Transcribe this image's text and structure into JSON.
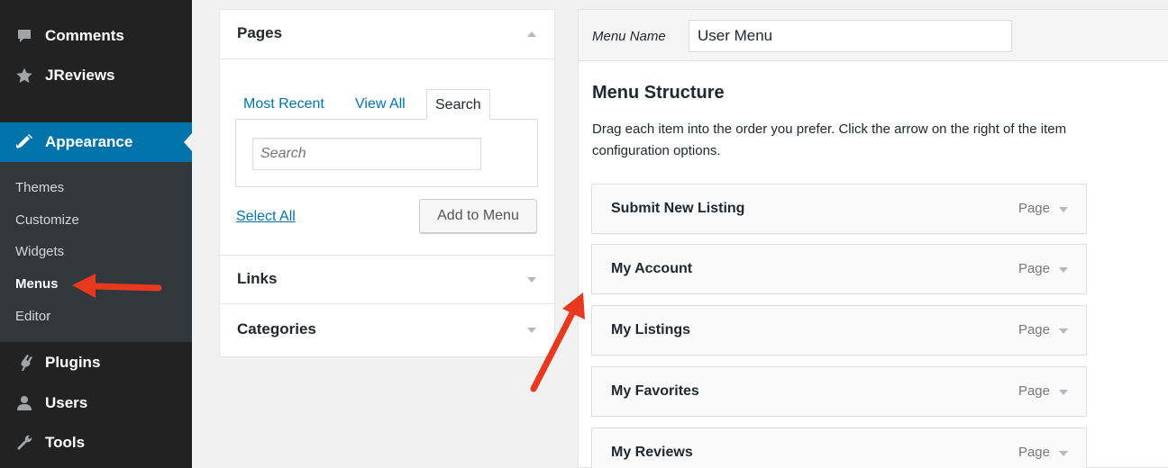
{
  "sidebar": {
    "items": [
      {
        "label": "Comments",
        "icon": "comments-icon"
      },
      {
        "label": "JReviews",
        "icon": "star-icon"
      },
      {
        "label": "Appearance",
        "icon": "appearance-icon"
      },
      {
        "label": "Plugins",
        "icon": "plugins-icon"
      },
      {
        "label": "Users",
        "icon": "users-icon"
      },
      {
        "label": "Tools",
        "icon": "tools-icon"
      }
    ],
    "submenu": [
      "Themes",
      "Customize",
      "Widgets",
      "Menus",
      "Editor"
    ],
    "active_item": "Appearance",
    "current_subitem": "Menus"
  },
  "left_panel": {
    "pages": {
      "title": "Pages",
      "tabs": [
        "Most Recent",
        "View All",
        "Search"
      ],
      "active_tab": "Search",
      "search_placeholder": "Search",
      "select_all": "Select All",
      "add_to_menu": "Add to Menu"
    },
    "links_title": "Links",
    "categories_title": "Categories"
  },
  "editor": {
    "menu_name_label": "Menu Name",
    "menu_name_value": "User Menu",
    "structure_title": "Menu Structure",
    "structure_desc_line1": "Drag each item into the order you prefer. Click the arrow on the right of the item",
    "structure_desc_line2": "configuration options.",
    "items": [
      {
        "title": "Submit New Listing",
        "type": "Page"
      },
      {
        "title": "My Account",
        "type": "Page"
      },
      {
        "title": "My Listings",
        "type": "Page"
      },
      {
        "title": "My Favorites",
        "type": "Page"
      },
      {
        "title": "My Reviews",
        "type": "Page"
      }
    ]
  },
  "colors": {
    "sidebar_bg": "#222222",
    "submenu_bg": "#32373c",
    "active_blue": "#0073aa",
    "annotation_red": "#e8391f"
  }
}
